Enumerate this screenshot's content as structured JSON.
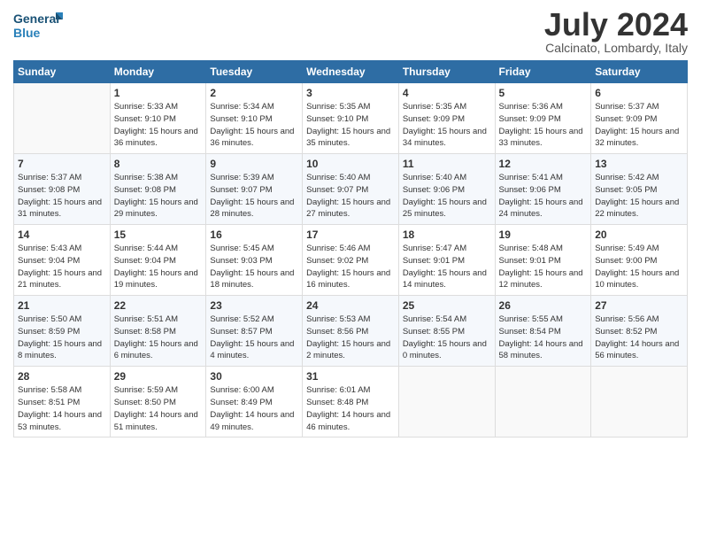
{
  "header": {
    "logo_general": "General",
    "logo_blue": "Blue",
    "month": "July 2024",
    "location": "Calcinato, Lombardy, Italy"
  },
  "days_of_week": [
    "Sunday",
    "Monday",
    "Tuesday",
    "Wednesday",
    "Thursday",
    "Friday",
    "Saturday"
  ],
  "weeks": [
    [
      {
        "day": "",
        "sunrise": "",
        "sunset": "",
        "daylight": ""
      },
      {
        "day": "1",
        "sunrise": "Sunrise: 5:33 AM",
        "sunset": "Sunset: 9:10 PM",
        "daylight": "Daylight: 15 hours and 36 minutes."
      },
      {
        "day": "2",
        "sunrise": "Sunrise: 5:34 AM",
        "sunset": "Sunset: 9:10 PM",
        "daylight": "Daylight: 15 hours and 36 minutes."
      },
      {
        "day": "3",
        "sunrise": "Sunrise: 5:35 AM",
        "sunset": "Sunset: 9:10 PM",
        "daylight": "Daylight: 15 hours and 35 minutes."
      },
      {
        "day": "4",
        "sunrise": "Sunrise: 5:35 AM",
        "sunset": "Sunset: 9:09 PM",
        "daylight": "Daylight: 15 hours and 34 minutes."
      },
      {
        "day": "5",
        "sunrise": "Sunrise: 5:36 AM",
        "sunset": "Sunset: 9:09 PM",
        "daylight": "Daylight: 15 hours and 33 minutes."
      },
      {
        "day": "6",
        "sunrise": "Sunrise: 5:37 AM",
        "sunset": "Sunset: 9:09 PM",
        "daylight": "Daylight: 15 hours and 32 minutes."
      }
    ],
    [
      {
        "day": "7",
        "sunrise": "Sunrise: 5:37 AM",
        "sunset": "Sunset: 9:08 PM",
        "daylight": "Daylight: 15 hours and 31 minutes."
      },
      {
        "day": "8",
        "sunrise": "Sunrise: 5:38 AM",
        "sunset": "Sunset: 9:08 PM",
        "daylight": "Daylight: 15 hours and 29 minutes."
      },
      {
        "day": "9",
        "sunrise": "Sunrise: 5:39 AM",
        "sunset": "Sunset: 9:07 PM",
        "daylight": "Daylight: 15 hours and 28 minutes."
      },
      {
        "day": "10",
        "sunrise": "Sunrise: 5:40 AM",
        "sunset": "Sunset: 9:07 PM",
        "daylight": "Daylight: 15 hours and 27 minutes."
      },
      {
        "day": "11",
        "sunrise": "Sunrise: 5:40 AM",
        "sunset": "Sunset: 9:06 PM",
        "daylight": "Daylight: 15 hours and 25 minutes."
      },
      {
        "day": "12",
        "sunrise": "Sunrise: 5:41 AM",
        "sunset": "Sunset: 9:06 PM",
        "daylight": "Daylight: 15 hours and 24 minutes."
      },
      {
        "day": "13",
        "sunrise": "Sunrise: 5:42 AM",
        "sunset": "Sunset: 9:05 PM",
        "daylight": "Daylight: 15 hours and 22 minutes."
      }
    ],
    [
      {
        "day": "14",
        "sunrise": "Sunrise: 5:43 AM",
        "sunset": "Sunset: 9:04 PM",
        "daylight": "Daylight: 15 hours and 21 minutes."
      },
      {
        "day": "15",
        "sunrise": "Sunrise: 5:44 AM",
        "sunset": "Sunset: 9:04 PM",
        "daylight": "Daylight: 15 hours and 19 minutes."
      },
      {
        "day": "16",
        "sunrise": "Sunrise: 5:45 AM",
        "sunset": "Sunset: 9:03 PM",
        "daylight": "Daylight: 15 hours and 18 minutes."
      },
      {
        "day": "17",
        "sunrise": "Sunrise: 5:46 AM",
        "sunset": "Sunset: 9:02 PM",
        "daylight": "Daylight: 15 hours and 16 minutes."
      },
      {
        "day": "18",
        "sunrise": "Sunrise: 5:47 AM",
        "sunset": "Sunset: 9:01 PM",
        "daylight": "Daylight: 15 hours and 14 minutes."
      },
      {
        "day": "19",
        "sunrise": "Sunrise: 5:48 AM",
        "sunset": "Sunset: 9:01 PM",
        "daylight": "Daylight: 15 hours and 12 minutes."
      },
      {
        "day": "20",
        "sunrise": "Sunrise: 5:49 AM",
        "sunset": "Sunset: 9:00 PM",
        "daylight": "Daylight: 15 hours and 10 minutes."
      }
    ],
    [
      {
        "day": "21",
        "sunrise": "Sunrise: 5:50 AM",
        "sunset": "Sunset: 8:59 PM",
        "daylight": "Daylight: 15 hours and 8 minutes."
      },
      {
        "day": "22",
        "sunrise": "Sunrise: 5:51 AM",
        "sunset": "Sunset: 8:58 PM",
        "daylight": "Daylight: 15 hours and 6 minutes."
      },
      {
        "day": "23",
        "sunrise": "Sunrise: 5:52 AM",
        "sunset": "Sunset: 8:57 PM",
        "daylight": "Daylight: 15 hours and 4 minutes."
      },
      {
        "day": "24",
        "sunrise": "Sunrise: 5:53 AM",
        "sunset": "Sunset: 8:56 PM",
        "daylight": "Daylight: 15 hours and 2 minutes."
      },
      {
        "day": "25",
        "sunrise": "Sunrise: 5:54 AM",
        "sunset": "Sunset: 8:55 PM",
        "daylight": "Daylight: 15 hours and 0 minutes."
      },
      {
        "day": "26",
        "sunrise": "Sunrise: 5:55 AM",
        "sunset": "Sunset: 8:54 PM",
        "daylight": "Daylight: 14 hours and 58 minutes."
      },
      {
        "day": "27",
        "sunrise": "Sunrise: 5:56 AM",
        "sunset": "Sunset: 8:52 PM",
        "daylight": "Daylight: 14 hours and 56 minutes."
      }
    ],
    [
      {
        "day": "28",
        "sunrise": "Sunrise: 5:58 AM",
        "sunset": "Sunset: 8:51 PM",
        "daylight": "Daylight: 14 hours and 53 minutes."
      },
      {
        "day": "29",
        "sunrise": "Sunrise: 5:59 AM",
        "sunset": "Sunset: 8:50 PM",
        "daylight": "Daylight: 14 hours and 51 minutes."
      },
      {
        "day": "30",
        "sunrise": "Sunrise: 6:00 AM",
        "sunset": "Sunset: 8:49 PM",
        "daylight": "Daylight: 14 hours and 49 minutes."
      },
      {
        "day": "31",
        "sunrise": "Sunrise: 6:01 AM",
        "sunset": "Sunset: 8:48 PM",
        "daylight": "Daylight: 14 hours and 46 minutes."
      },
      {
        "day": "",
        "sunrise": "",
        "sunset": "",
        "daylight": ""
      },
      {
        "day": "",
        "sunrise": "",
        "sunset": "",
        "daylight": ""
      },
      {
        "day": "",
        "sunrise": "",
        "sunset": "",
        "daylight": ""
      }
    ]
  ]
}
